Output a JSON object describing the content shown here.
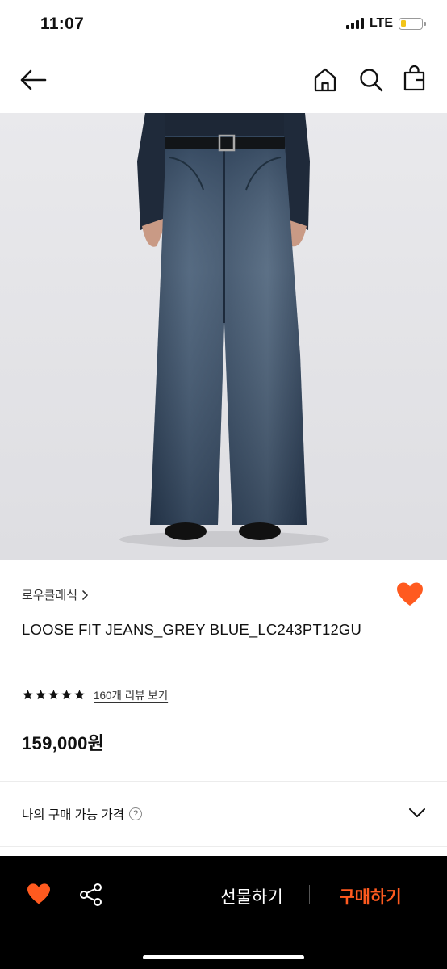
{
  "status": {
    "time": "11:07",
    "network": "LTE",
    "battery_level": 0.25,
    "battery_color": "#f2c418"
  },
  "nav": {
    "back_icon": "arrow-left-icon",
    "home_icon": "home-icon",
    "search_icon": "search-icon",
    "bag_icon": "shopping-bag-icon"
  },
  "product": {
    "image_icon": "product-photo",
    "brand": "로우클래식",
    "brand_arrow": "›",
    "title": "LOOSE FIT JEANS_GREY BLUE_LC243PT12GU",
    "rating_stars": 5,
    "review_link": "160개 리뷰 보기",
    "price": "159,000원",
    "wishlisted": true,
    "accent_color": "#ff5a1f"
  },
  "my_price": {
    "label": "나의 구매 가능 가격",
    "help_symbol": "?"
  },
  "bottom_bar": {
    "gift_label": "선물하기",
    "buy_label": "구매하기",
    "buy_color": "#ff5a1f",
    "wish_icon": "heart-icon",
    "share_icon": "share-icon"
  }
}
